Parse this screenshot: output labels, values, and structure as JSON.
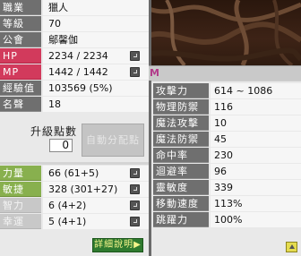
{
  "basic": [
    {
      "label": "職業",
      "value": "獵人"
    },
    {
      "label": "等級",
      "value": "70"
    },
    {
      "label": "公會",
      "value": "鄔馨伽"
    },
    {
      "label": "HP",
      "value": "2234 / 2234"
    },
    {
      "label": "MP",
      "value": "1442 / 1442"
    },
    {
      "label": "經驗值",
      "value": "103569 (5%)"
    },
    {
      "label": "名聲",
      "value": "18"
    }
  ],
  "ap": {
    "title": "升級點數",
    "value": "0",
    "auto_button": "自動分配點"
  },
  "stats": [
    {
      "label": "力量",
      "value": "66 (61+5)"
    },
    {
      "label": "敏捷",
      "value": "328 (301+27)"
    },
    {
      "label": "智力",
      "value": "6 (4+2)"
    },
    {
      "label": "幸運",
      "value": "5 (4+1)"
    }
  ],
  "detail_button": "詳細說明▶",
  "tab_marker": "M",
  "detail_stats": [
    {
      "label": "攻擊力",
      "value": "614 ~ 1086"
    },
    {
      "label": "物理防禦力",
      "value": "116"
    },
    {
      "label": "魔法攻擊力",
      "value": "10"
    },
    {
      "label": "魔法防禦力",
      "value": "45"
    },
    {
      "label": "命中率",
      "value": "230"
    },
    {
      "label": "迴避率",
      "value": "96"
    },
    {
      "label": "靈敏度",
      "value": "339"
    },
    {
      "label": "移動速度",
      "value": "113%"
    },
    {
      "label": "跳躍力",
      "value": "100%"
    }
  ],
  "colors": {
    "label_gray": "#6f6f6f",
    "label_red": "#d23a5c",
    "label_green": "#88b04e",
    "detail_button_bg": "#2f7a2f"
  }
}
